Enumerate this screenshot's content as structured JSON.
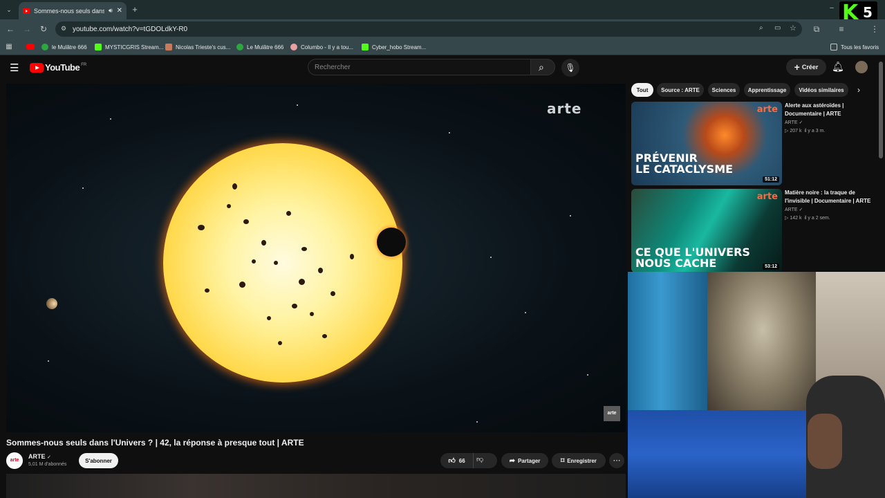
{
  "browser": {
    "tab_title": "Sommes-nous seuls dans l'",
    "url": "youtube.com/watch?v=tGDOLdkY-R0",
    "bookmarks": [
      {
        "label": "le Mulâtre 666",
        "color": "#2ba640"
      },
      {
        "label": "MYSTICGRIS Stream...",
        "color": "#53fc18"
      },
      {
        "label": "Nicolas Trieste's cus...",
        "color": "#c97a5a"
      },
      {
        "label": "Le Mulâtre 666",
        "color": "#2ba640"
      },
      {
        "label": "Columbo - Il y a tou...",
        "color": "#e8a0a0"
      },
      {
        "label": "Cyber_hobo Stream...",
        "color": "#53fc18"
      }
    ],
    "all_bookmarks_label": "Tous les favoris"
  },
  "overlay_logo": {
    "letter": "K",
    "number": "5"
  },
  "youtube": {
    "logo_text": "YouTube",
    "country_code": "FR",
    "search_placeholder": "Rechercher",
    "create_label": "Créer",
    "chips": [
      "Tout",
      "Source : ARTE",
      "Sciences",
      "Apprentissage",
      "Vidéos similaires"
    ],
    "video": {
      "watermark": "arte",
      "corner_logo": "arte",
      "title": "Sommes-nous seuls dans l'Univers ? | 42, la réponse à presque tout | ARTE",
      "channel": "ARTE",
      "channel_avatar_text": "arte",
      "subscribers": "5,01 M d'abonnés",
      "subscribe_label": "S'abonner",
      "likes": "66",
      "share_label": "Partager",
      "save_label": "Enregistrer"
    },
    "suggestions": [
      {
        "title": "Alerte aux astéroïdes | Documentaire | ARTE",
        "channel": "ARTE",
        "views": "207 k",
        "age": "il y a 3 m.",
        "duration": "51:12",
        "thumb_text_1": "PRÉVENIR",
        "thumb_text_2": "LE CATACLYSME",
        "thumb_brand": "arte"
      },
      {
        "title": "Matière noire : la traque de l'invisible | Documentaire | ARTE",
        "channel": "ARTE",
        "views": "142 k",
        "age": "il y a 2 sem.",
        "duration": "53:12",
        "thumb_text_1": "CE QUE L'UNIVERS",
        "thumb_text_2": "NOUS CACHE",
        "thumb_brand": "arte"
      }
    ]
  }
}
